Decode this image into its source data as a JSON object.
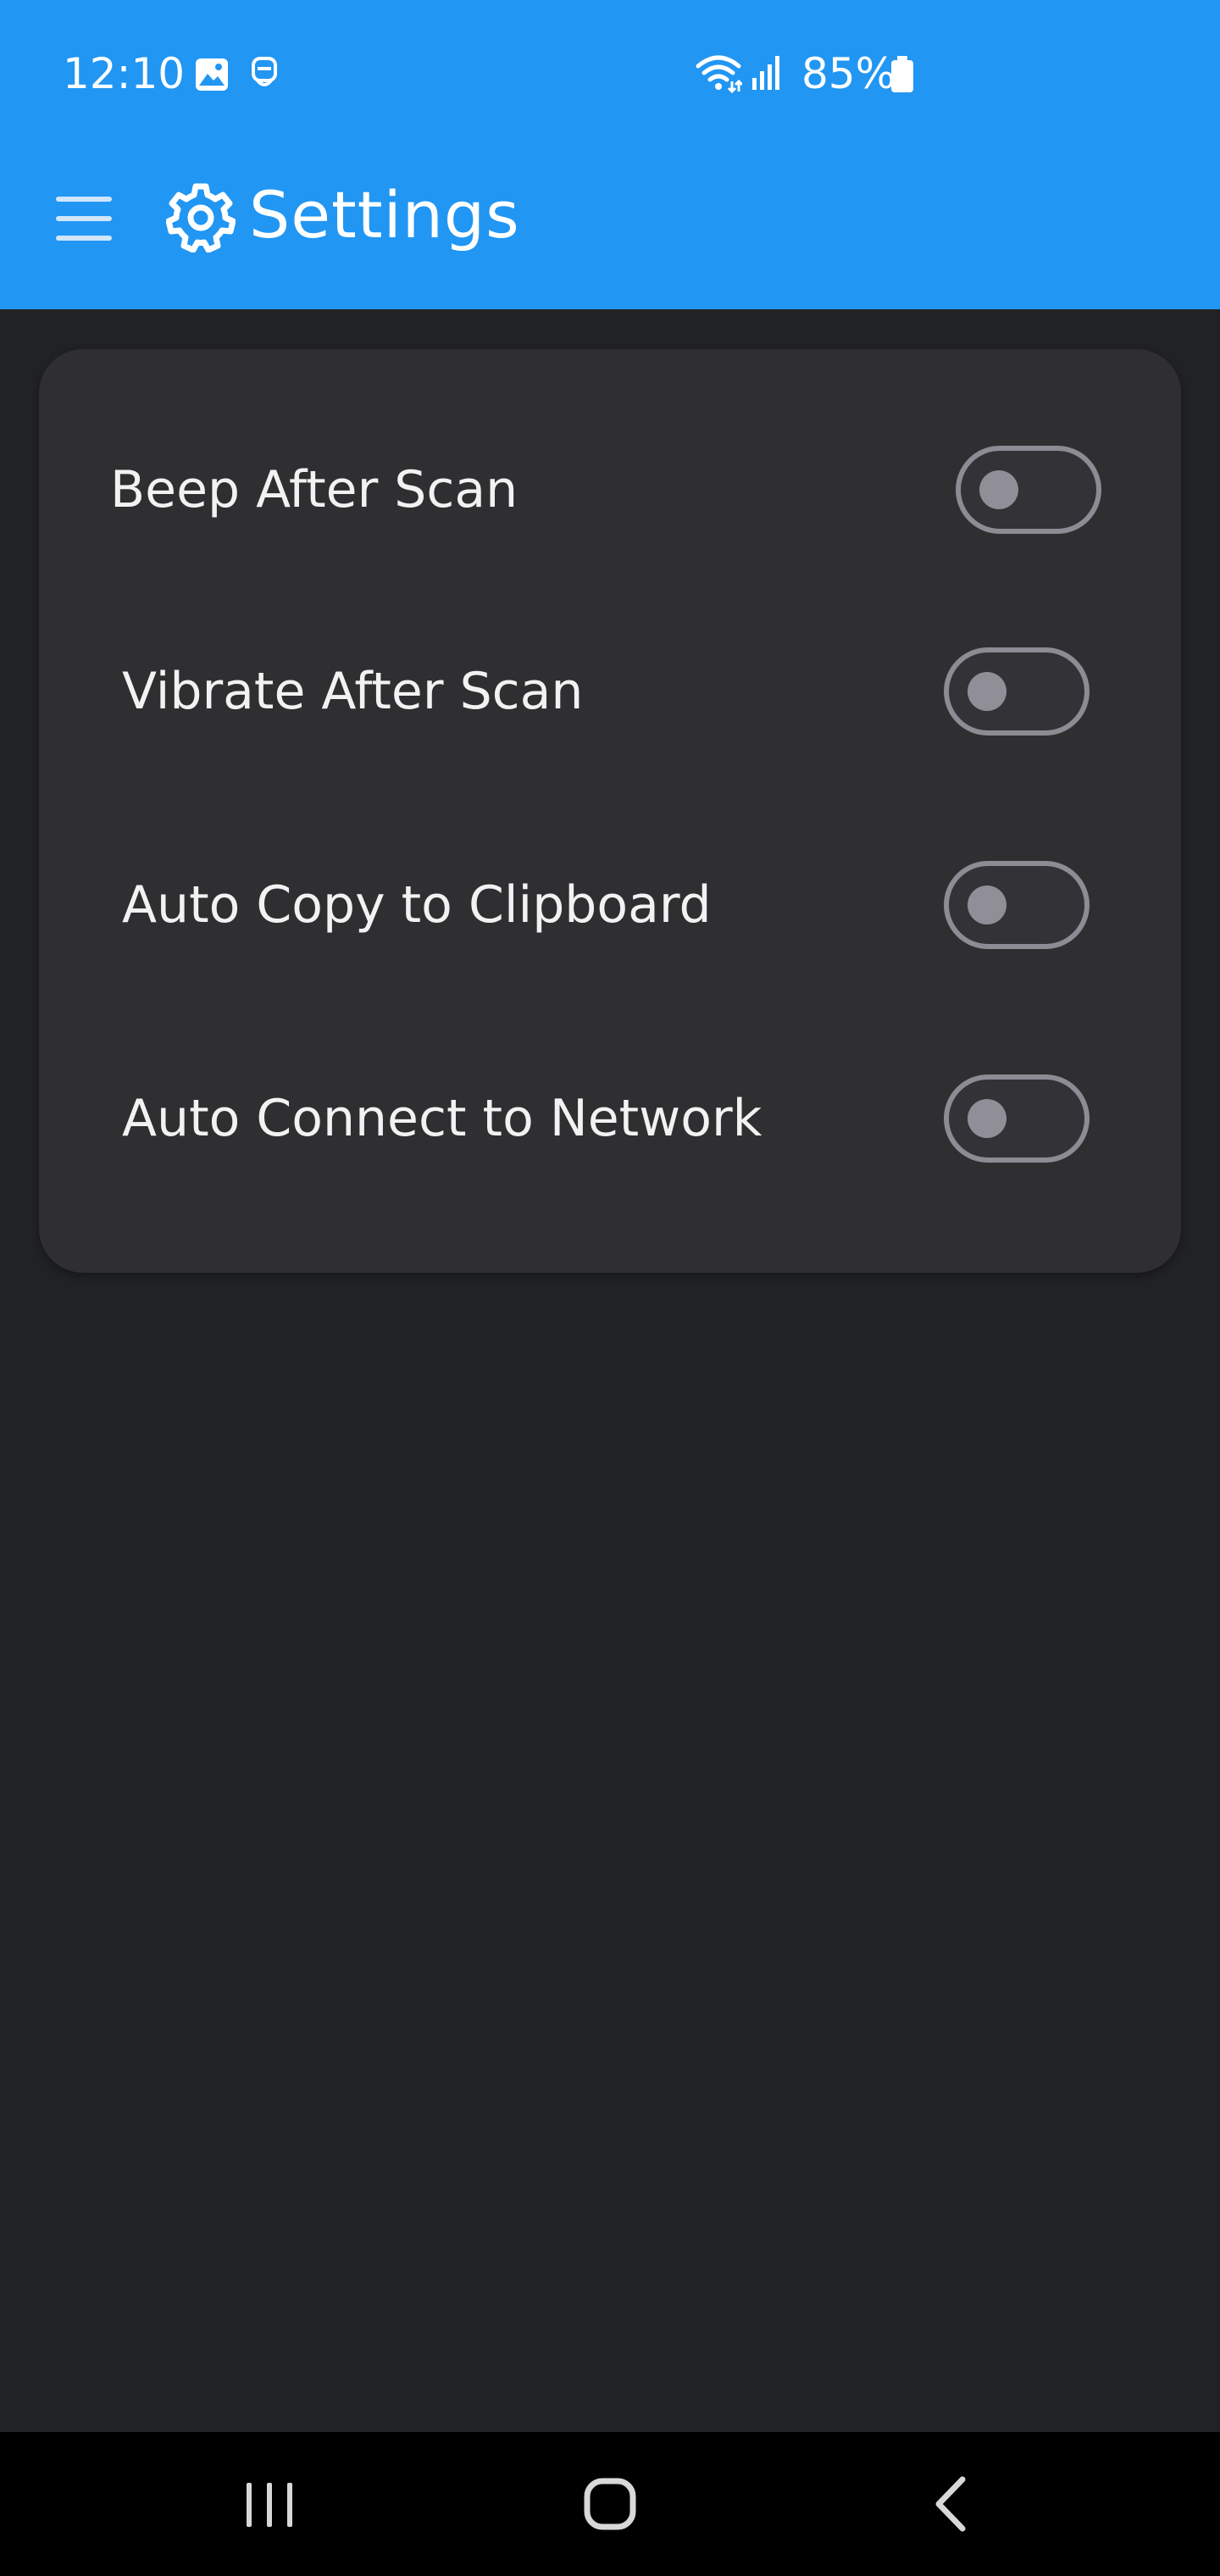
{
  "status_bar": {
    "time": "12:10",
    "battery": "85%",
    "icons": [
      "gallery-icon",
      "assistant-icon",
      "wifi-icon",
      "signal-icon",
      "battery-icon"
    ]
  },
  "app_bar": {
    "title": "Settings",
    "menu_icon": "hamburger-menu-icon",
    "title_icon": "gear-icon",
    "background_color": "#2196f3"
  },
  "settings": [
    {
      "label": "Beep After Scan",
      "enabled": false
    },
    {
      "label": "Vibrate After Scan",
      "enabled": false
    },
    {
      "label": "Auto Copy to Clipboard",
      "enabled": false
    },
    {
      "label": "Auto Connect to Network",
      "enabled": false
    }
  ],
  "nav_bar": {
    "buttons": [
      "recent-apps-icon",
      "home-icon",
      "back-icon"
    ]
  }
}
